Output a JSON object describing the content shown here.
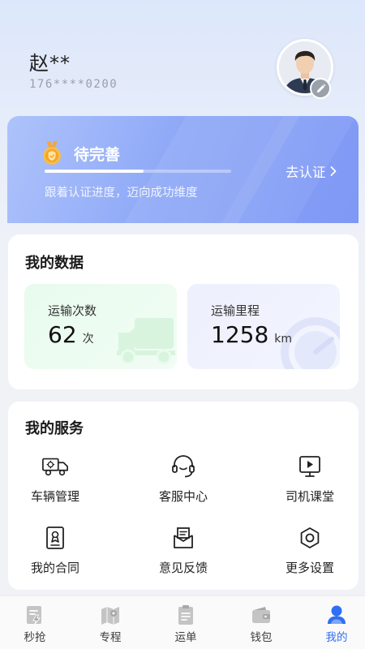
{
  "user": {
    "name": "赵**",
    "phone": "176****0200"
  },
  "certification": {
    "status": "待完善",
    "progress": 0.53,
    "description": "跟着认证进度，迈向成功维度",
    "link_label": "去认证"
  },
  "my_data": {
    "title": "我的数据",
    "trips": {
      "label": "运输次数",
      "value": "62",
      "unit": "次"
    },
    "mileage": {
      "label": "运输里程",
      "value": "1258",
      "unit": "km"
    }
  },
  "services": {
    "title": "我的服务",
    "items": [
      {
        "label": "车辆管理",
        "icon": "truck-icon"
      },
      {
        "label": "客服中心",
        "icon": "headset-icon"
      },
      {
        "label": "司机课堂",
        "icon": "video-class-icon"
      },
      {
        "label": "我的合同",
        "icon": "contract-icon"
      },
      {
        "label": "意见反馈",
        "icon": "feedback-icon"
      },
      {
        "label": "更多设置",
        "icon": "settings-icon"
      }
    ]
  },
  "tabs": [
    {
      "label": "秒抢",
      "icon": "grab-order-icon",
      "active": false
    },
    {
      "label": "专程",
      "icon": "map-route-icon",
      "active": false
    },
    {
      "label": "运单",
      "icon": "waybill-icon",
      "active": false
    },
    {
      "label": "钱包",
      "icon": "wallet-icon",
      "active": false
    },
    {
      "label": "我的",
      "icon": "profile-icon",
      "active": true
    }
  ],
  "colors": {
    "accent": "#2e6ff3",
    "card_gradient_start": "#aec3fb",
    "card_gradient_end": "#7e98f5",
    "trips_bg": "#e8fbee",
    "mileage_bg": "#edf0fd"
  }
}
